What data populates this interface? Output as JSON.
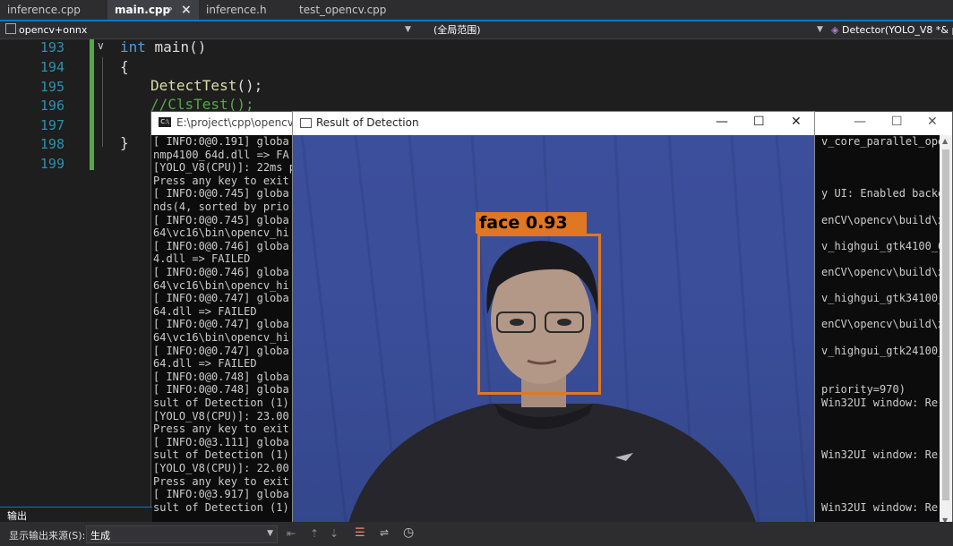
{
  "tabs": [
    {
      "label": "inference.cpp",
      "active": false
    },
    {
      "label": "main.cpp",
      "active": true,
      "pin": "⊸",
      "close": "×"
    },
    {
      "label": "inference.h",
      "active": false
    },
    {
      "label": "test_opencv.cpp",
      "active": false
    }
  ],
  "navbar": {
    "project": "opencv+onnx",
    "scope": "(全局范围)",
    "member": "Detector(YOLO_V8 *& p"
  },
  "editor": {
    "line_numbers": [
      "193",
      "194",
      "195",
      "196",
      "197",
      "198",
      "199"
    ],
    "code": {
      "l193_kw": "int",
      "l193_rest": " main()",
      "l194": "{",
      "l195_fn": "DetectTest",
      "l195_rest": "();",
      "l196": "//ClsTest();",
      "l198": "}"
    }
  },
  "console": {
    "title": "E:\\project\\cpp\\opencv+o",
    "lines": [
      "[ INFO:0@0.191] globa",
      "nmp4100_64d.dll => FA",
      "[YOLO_V8(CPU)]: 22ms p",
      "Press any key to exit",
      "[ INFO:0@0.745] globa",
      "nds(4, sorted by prio",
      "[ INFO:0@0.745] globa",
      "64\\vc16\\bin\\opencv_hi",
      "[ INFO:0@0.746] globa",
      "4.dll => FAILED",
      "[ INFO:0@0.746] globa",
      "64\\vc16\\bin\\opencv_hi",
      "[ INFO:0@0.747] globa",
      "64.dll => FAILED",
      "[ INFO:0@0.747] globa",
      "64\\vc16\\bin\\opencv_hi",
      "[ INFO:0@0.747] globa",
      "64.dll => FAILED",
      "[ INFO:0@0.748] globa",
      "[ INFO:0@0.748] globa",
      "sult of Detection (1)",
      "[YOLO_V8(CPU)]: 23.00",
      "Press any key to exit",
      "[ INFO:0@3.111] globa",
      "sult of Detection (1)",
      "[YOLO_V8(CPU)]: 22.00",
      "Press any key to exit",
      "[ INFO:0@3.917] globa",
      "sult of Detection (1)"
    ],
    "right_lines": [
      "v_core_parallel_ope",
      "",
      "",
      "",
      "y UI: Enabled backe",
      "",
      "enCV\\opencv\\build\\x",
      "",
      "v_highgui_gtk4100_6",
      "",
      "enCV\\opencv\\build\\x",
      "",
      "v_highgui_gtk34100_",
      "",
      "enCV\\opencv\\build\\x",
      "",
      "v_highgui_gtk24100_",
      "",
      "",
      "priority=970)",
      "Win32UI window: Re",
      "",
      "",
      "",
      "Win32UI window: Re",
      "",
      "",
      "",
      "Win32UI window: Re"
    ],
    "minimize": "—",
    "maximize": "☐",
    "close": "✕"
  },
  "result_window": {
    "title": "Result of Detection",
    "minimize": "—",
    "maximize": "☐",
    "close": "✕",
    "detection": {
      "label": "face 0.93",
      "box_color": "#e07722"
    }
  },
  "output_panel": {
    "title": "输出",
    "source_label": "显示输出来源(S):",
    "source_value": "生成"
  },
  "colors": {
    "accent": "#007acc",
    "line_number": "#2b91af",
    "keyword": "#569cd6",
    "comment": "#57a64a",
    "function": "#dcdcaa"
  }
}
